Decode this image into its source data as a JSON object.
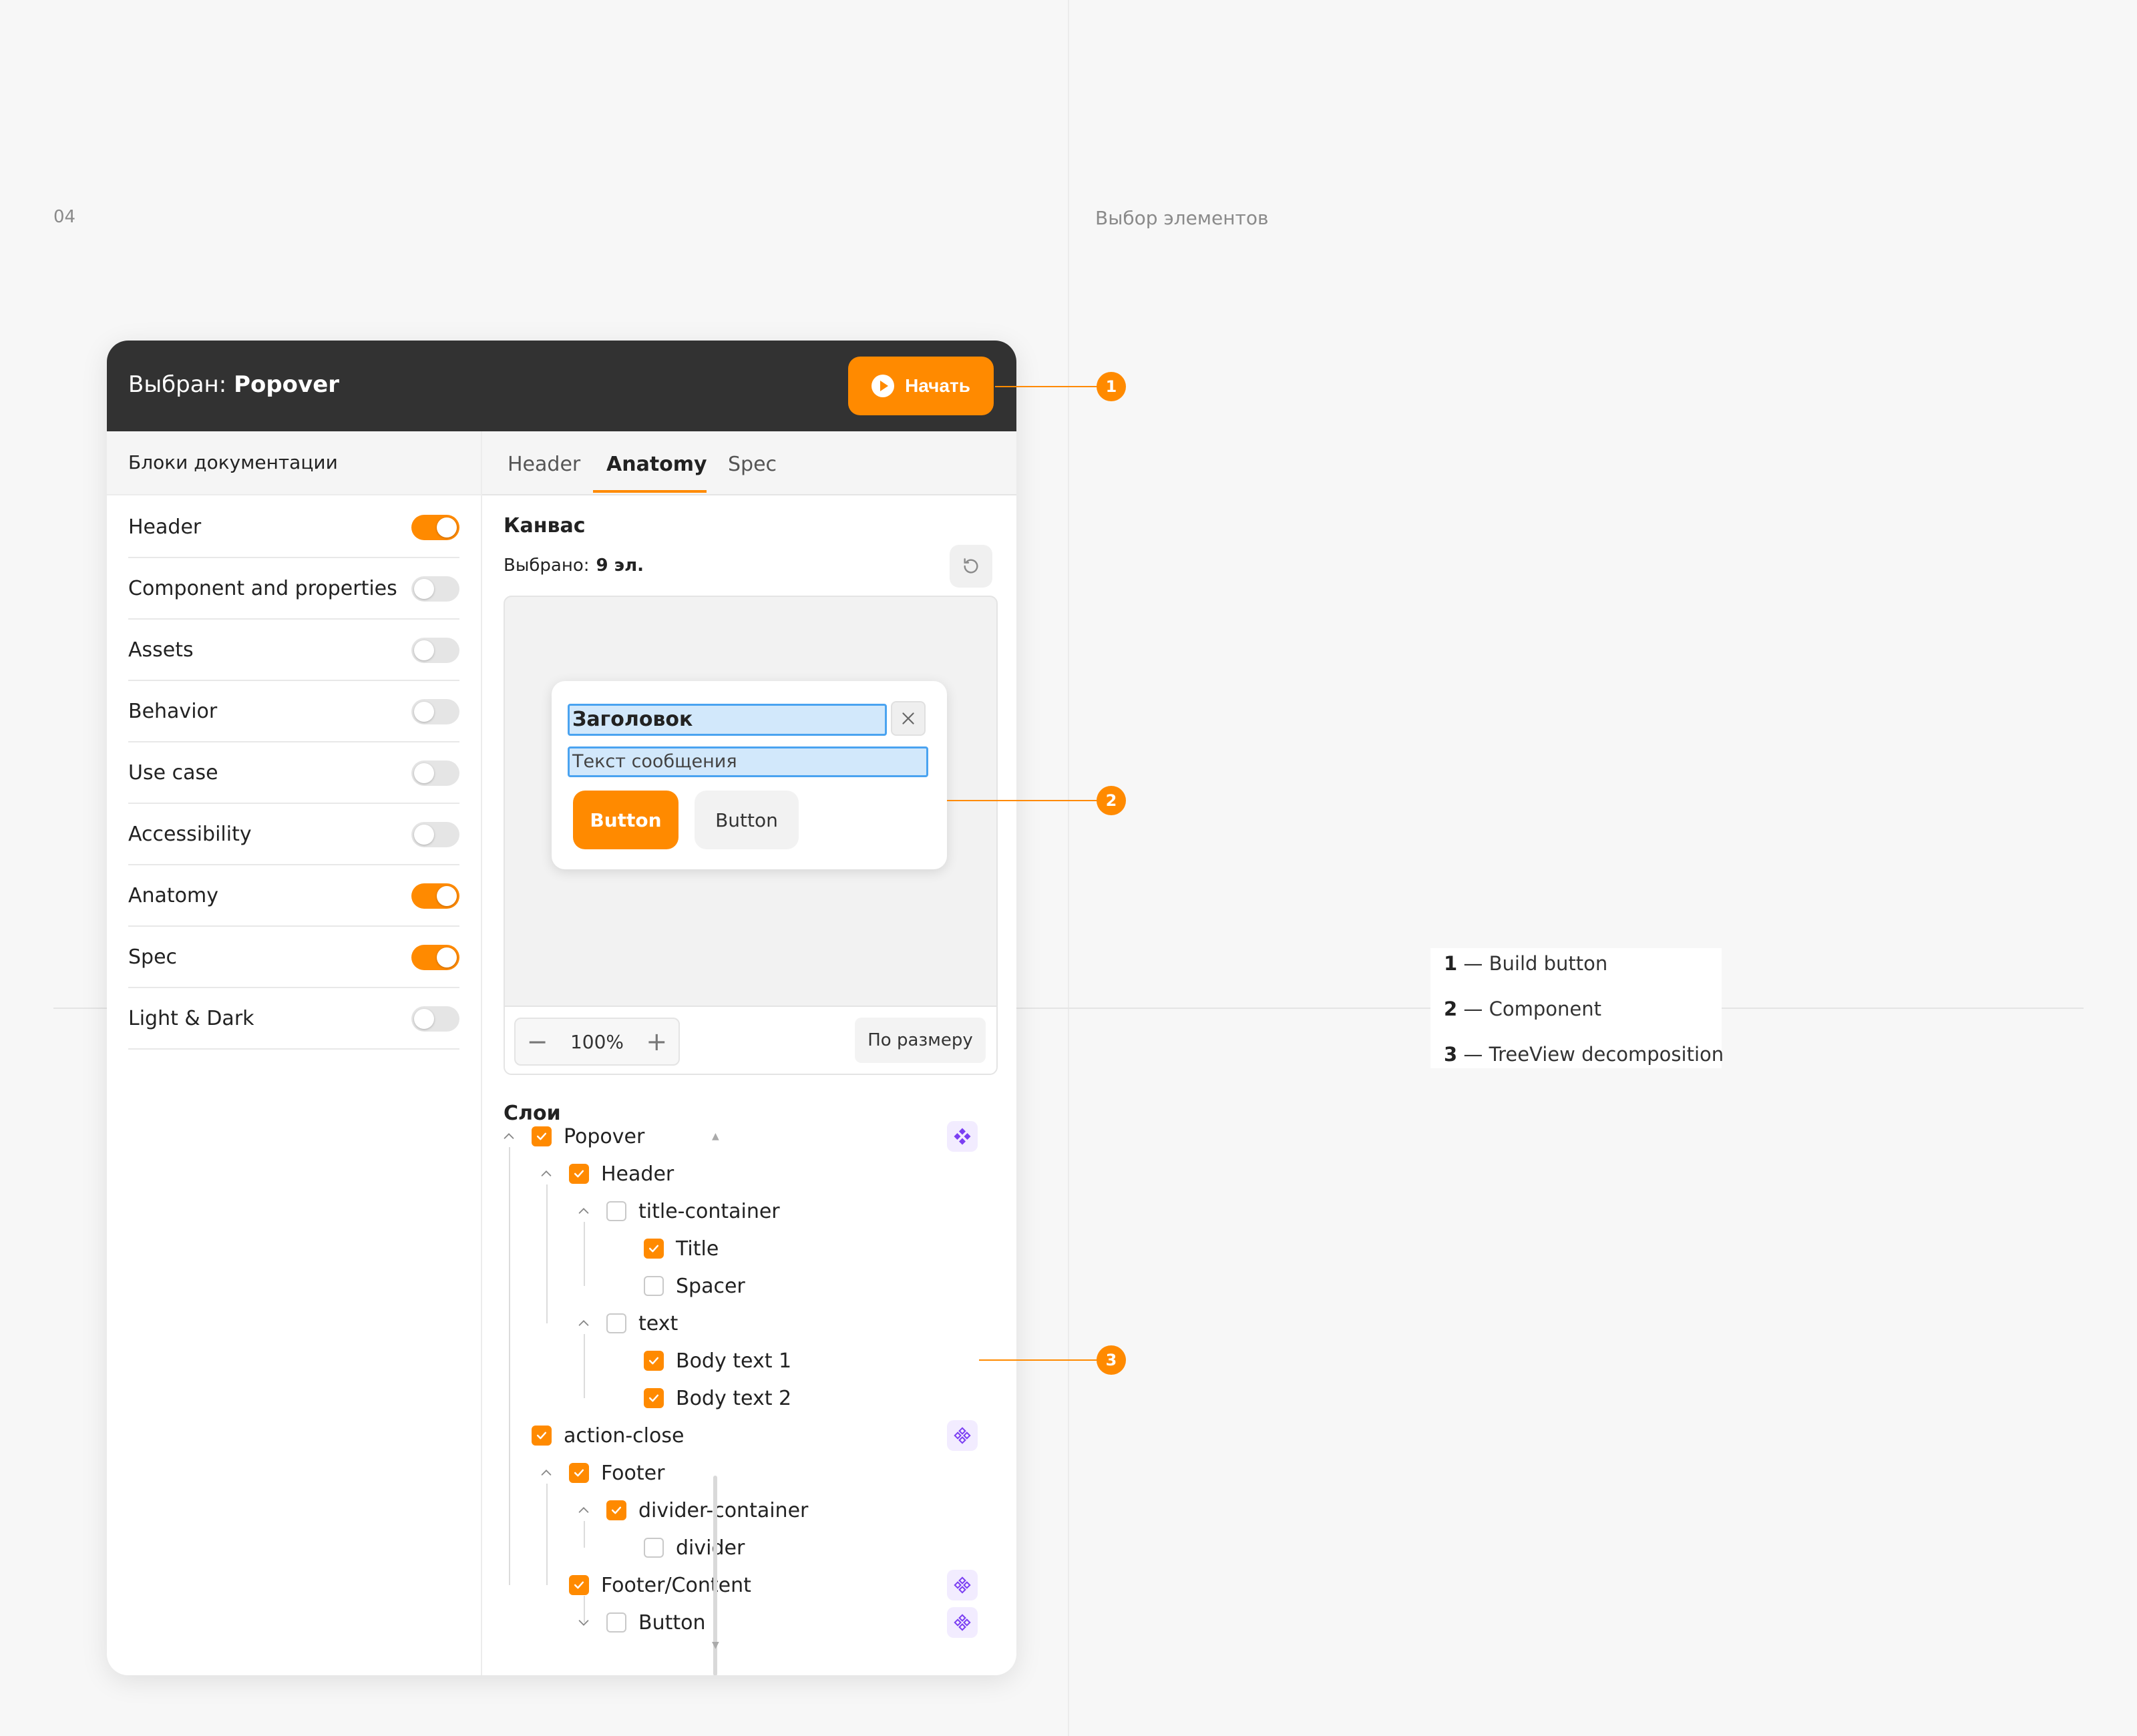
{
  "page": {
    "number": "04",
    "caption": "Выбор элементов"
  },
  "window": {
    "title_prefix": "Выбран:",
    "title_value": "Popover",
    "start_label": "Начать"
  },
  "left_panel": {
    "heading": "Блоки документации",
    "blocks": [
      {
        "label": "Header",
        "enabled": true
      },
      {
        "label": "Component and properties",
        "enabled": false
      },
      {
        "label": "Assets",
        "enabled": false
      },
      {
        "label": "Behavior",
        "enabled": false
      },
      {
        "label": "Use case",
        "enabled": false
      },
      {
        "label": "Accessibility",
        "enabled": false
      },
      {
        "label": "Anatomy",
        "enabled": true
      },
      {
        "label": "Spec",
        "enabled": true
      },
      {
        "label": "Light & Dark",
        "enabled": false
      }
    ]
  },
  "tabs": [
    {
      "label": "Header",
      "active": false
    },
    {
      "label": "Anatomy",
      "active": true
    },
    {
      "label": "Spec",
      "active": false
    }
  ],
  "canvas": {
    "heading": "Канвас",
    "selected_label": "Выбрано:",
    "selected_count": "9 эл.",
    "zoom_value": "100%",
    "fit_label": "По размеру",
    "preview": {
      "title": "Заголовок",
      "message": "Текст сообщения",
      "primary_button": "Button",
      "secondary_button": "Button"
    }
  },
  "layers": {
    "heading": "Слои",
    "items": [
      {
        "label": "Popover",
        "checked": true,
        "expanded": "up",
        "component": "filled"
      },
      {
        "label": "Header",
        "checked": true,
        "expanded": "up",
        "component": ""
      },
      {
        "label": "title-container",
        "checked": false,
        "expanded": "up",
        "component": ""
      },
      {
        "label": "Title",
        "checked": true,
        "expanded": "",
        "component": ""
      },
      {
        "label": "Spacer",
        "checked": false,
        "expanded": "",
        "component": ""
      },
      {
        "label": "text",
        "checked": false,
        "expanded": "up",
        "component": ""
      },
      {
        "label": "Body text 1",
        "checked": true,
        "expanded": "",
        "component": ""
      },
      {
        "label": "Body text 2",
        "checked": true,
        "expanded": "",
        "component": ""
      },
      {
        "label": "action-close",
        "checked": true,
        "expanded": "",
        "component": "outline"
      },
      {
        "label": "Footer",
        "checked": true,
        "expanded": "up",
        "component": ""
      },
      {
        "label": "divider-container",
        "checked": true,
        "expanded": "up",
        "component": ""
      },
      {
        "label": "divider",
        "checked": false,
        "expanded": "",
        "component": ""
      },
      {
        "label": "Footer/Content",
        "checked": true,
        "expanded": "",
        "component": "outline"
      },
      {
        "label": "Button",
        "checked": false,
        "expanded": "down",
        "component": "outline"
      }
    ]
  },
  "callouts": [
    "1",
    "2",
    "3"
  ],
  "legend": [
    {
      "num": "1",
      "dash": "—",
      "text": "Build button"
    },
    {
      "num": "2",
      "dash": "—",
      "text": "Component"
    },
    {
      "num": "3",
      "dash": "—",
      "text": "TreeView decomposition"
    }
  ],
  "colors": {
    "accent": "#ff8a00",
    "titlebar": "#323232",
    "component_icon": "#7b3ff2",
    "highlight": "#4aa3f0"
  }
}
